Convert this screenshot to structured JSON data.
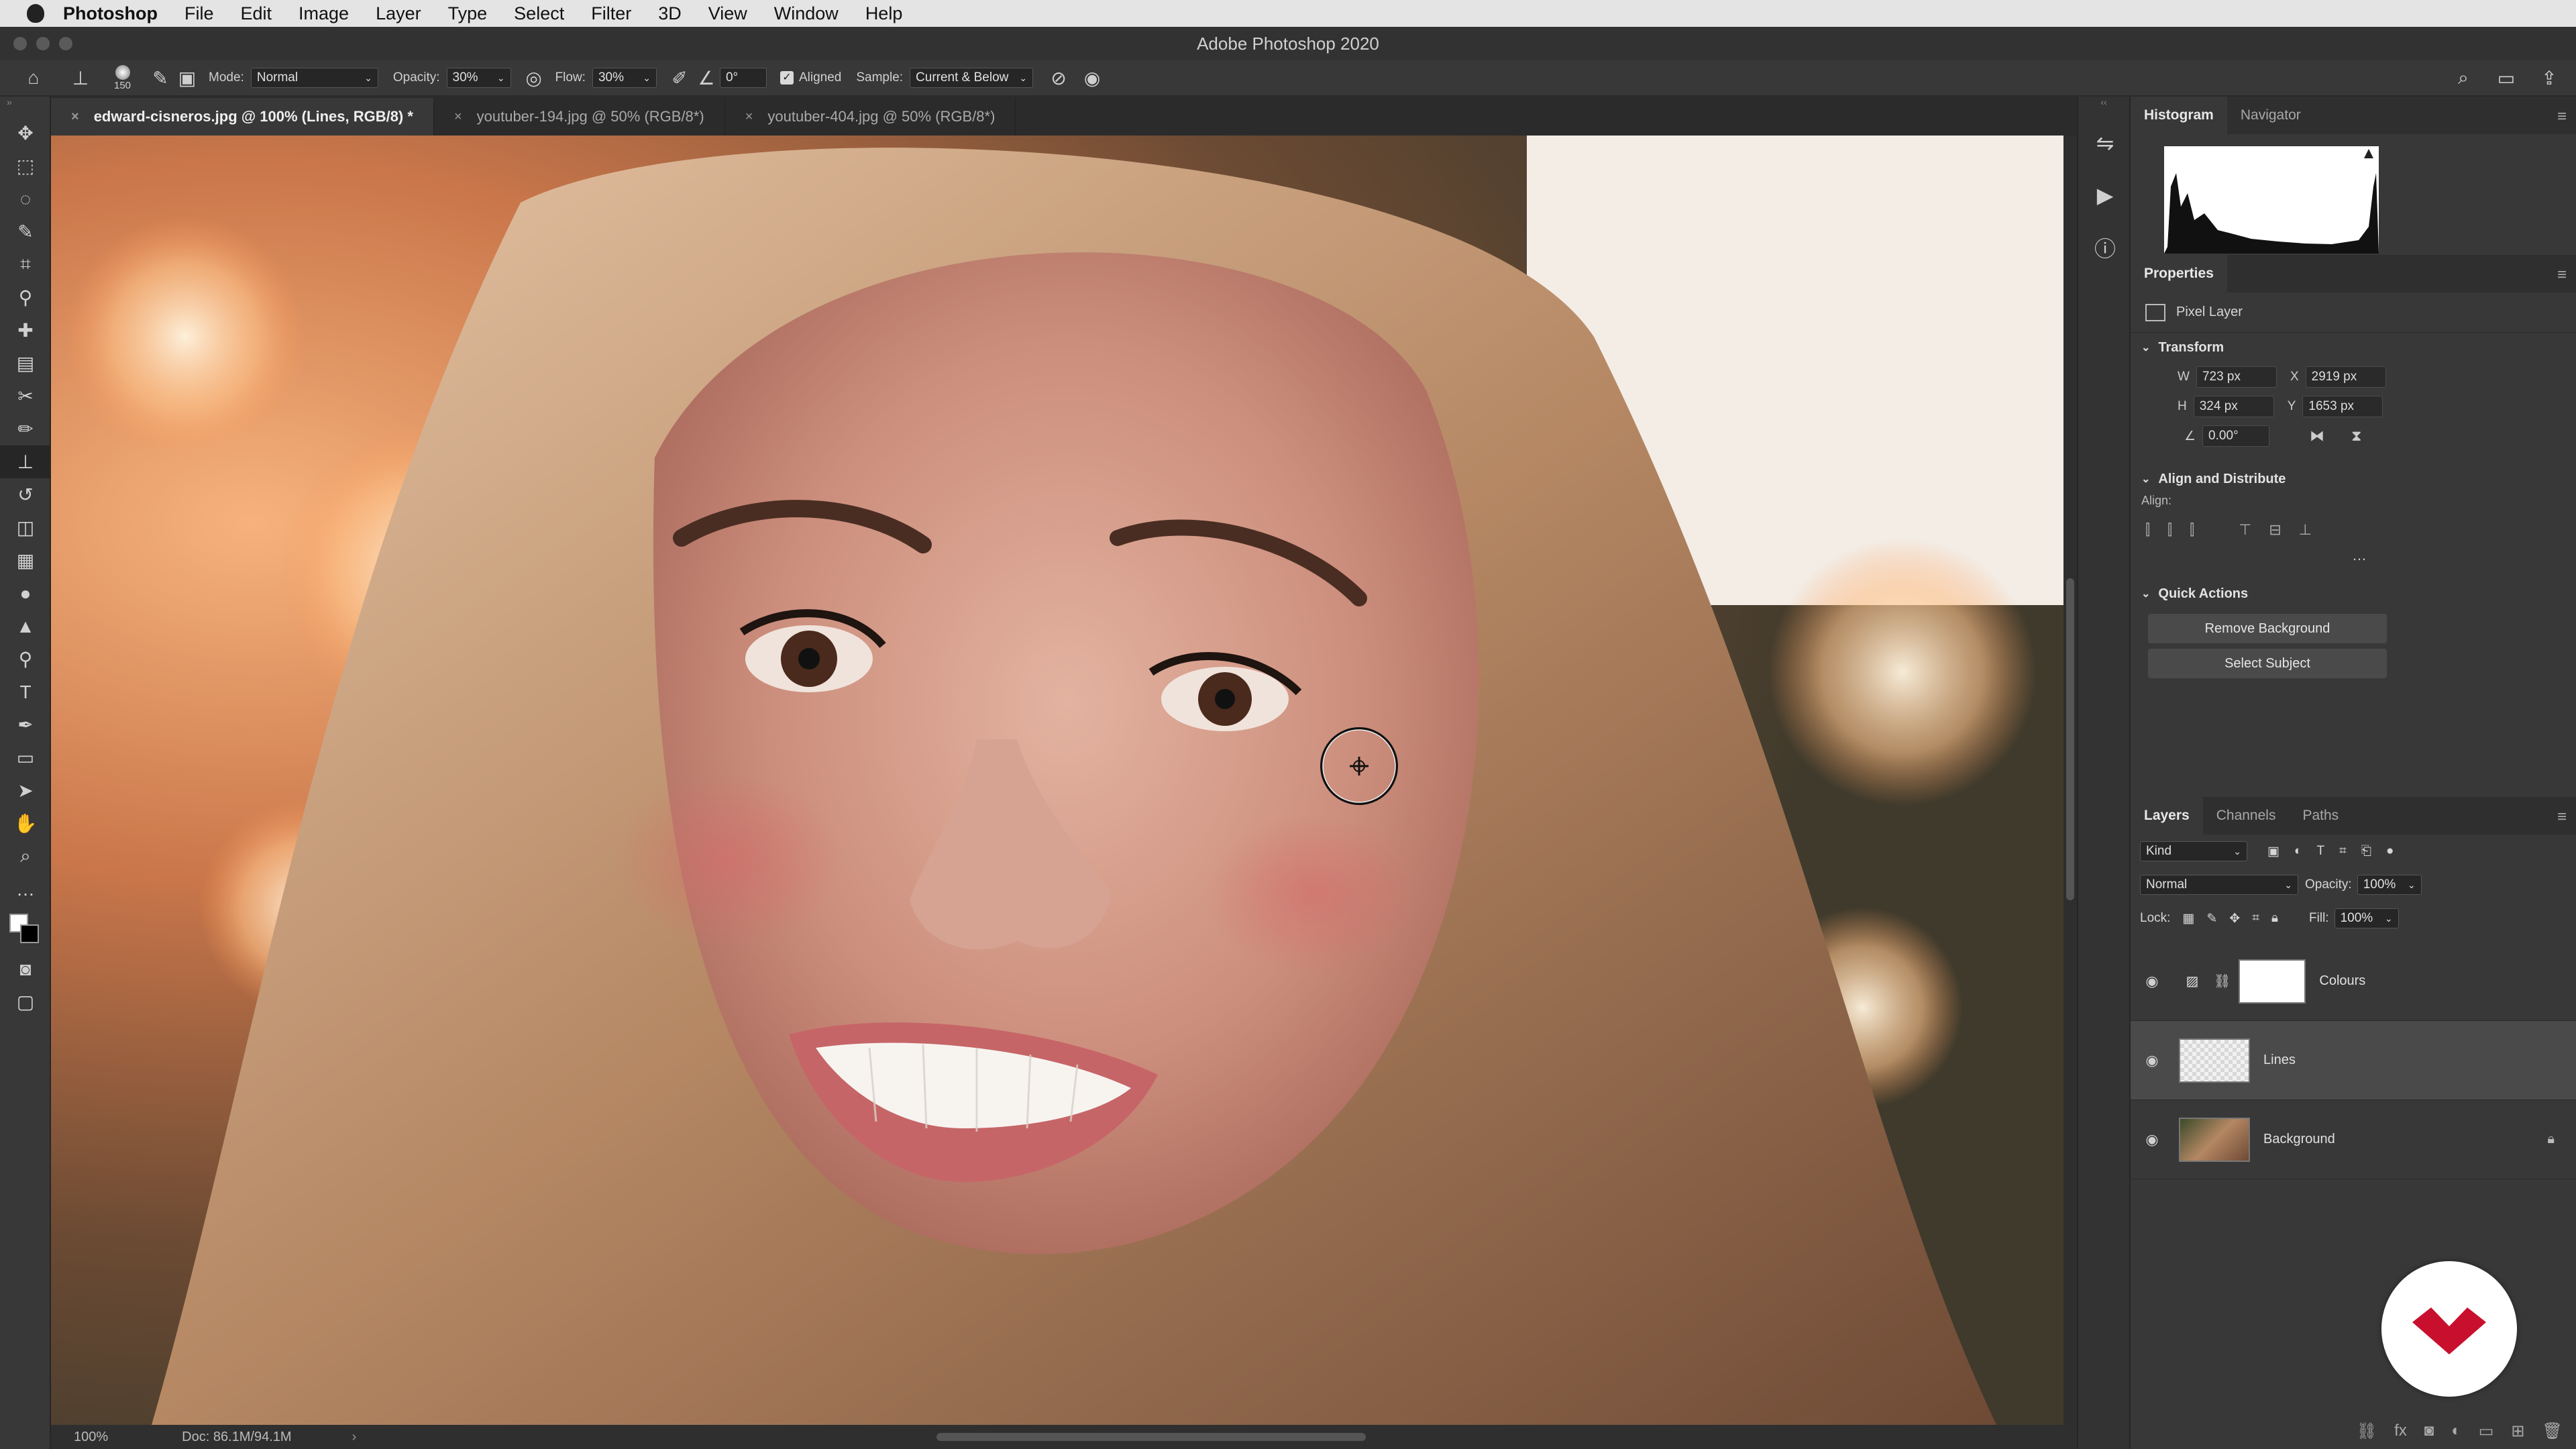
{
  "menubar": {
    "app_name": "Photoshop",
    "items": [
      "File",
      "Edit",
      "Image",
      "Layer",
      "Type",
      "Select",
      "Filter",
      "3D",
      "View",
      "Window",
      "Help"
    ]
  },
  "window": {
    "title": "Adobe Photoshop 2020"
  },
  "options": {
    "brush_size": "150",
    "mode_label": "Mode:",
    "mode_value": "Normal",
    "opacity_label": "Opacity:",
    "opacity_value": "30%",
    "flow_label": "Flow:",
    "flow_value": "30%",
    "angle_value": "0°",
    "aligned_label": "Aligned",
    "sample_label": "Sample:",
    "sample_value": "Current & Below"
  },
  "tabs": [
    {
      "label": "edward-cisneros.jpg @ 100% (Lines, RGB/8) *"
    },
    {
      "label": "youtuber-194.jpg @ 50% (RGB/8*)"
    },
    {
      "label": "youtuber-404.jpg @ 50% (RGB/8*)"
    }
  ],
  "status": {
    "zoom": "100%",
    "doc": "Doc: 86.1M/94.1M"
  },
  "histogram": {
    "tab_histogram": "Histogram",
    "tab_navigator": "Navigator"
  },
  "properties": {
    "title": "Properties",
    "layer_type": "Pixel Layer",
    "transform_title": "Transform",
    "w_label": "W",
    "w_value": "723 px",
    "x_label": "X",
    "x_value": "2919 px",
    "h_label": "H",
    "h_value": "324 px",
    "y_label": "Y",
    "y_value": "1653 px",
    "angle_value": "0.00°",
    "align_title": "Align and Distribute",
    "align_label": "Align:",
    "quick_actions_title": "Quick Actions",
    "remove_bg": "Remove Background",
    "select_subject": "Select Subject"
  },
  "layers_panel": {
    "tab_layers": "Layers",
    "tab_channels": "Channels",
    "tab_paths": "Paths",
    "filter_kind": "Kind",
    "blend_mode": "Normal",
    "opacity_label": "Opacity:",
    "opacity_value": "100%",
    "lock_label": "Lock:",
    "fill_label": "Fill:",
    "fill_value": "100%",
    "layers": [
      {
        "name": "Colours"
      },
      {
        "name": "Lines"
      },
      {
        "name": "Background"
      }
    ]
  }
}
